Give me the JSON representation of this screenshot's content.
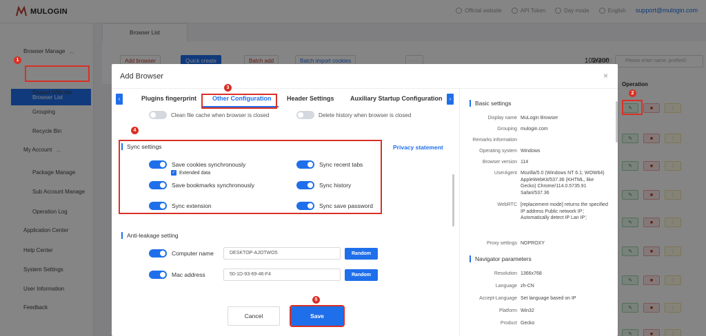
{
  "app": {
    "logo_text": "MULOGIN",
    "top_links": [
      "Official website",
      "API Token",
      "Day mode",
      "English"
    ],
    "email": "support@mulogin.com"
  },
  "sidebar": {
    "browser_manage": "Browser Manage",
    "browser_list": "Browser List",
    "shared_with_me": "Shared With Me",
    "grouping": "Grouping",
    "recycle_bin": "Recycle Bin",
    "my_account": "My Account",
    "package_manage": "Package Manage",
    "sub_account_manage": "Sub Account Manage",
    "operation_log": "Operation Log",
    "application_center": "Application Center",
    "help_center": "Help Center",
    "system_settings": "System Settings",
    "user_information": "User Information",
    "feedback": "Feedback"
  },
  "main": {
    "tab_label": "Browser List",
    "toolbar": {
      "add_browser": "Add browser",
      "quick_create": "Quick create",
      "batch_add": "Batch add",
      "batch_import": "Batch import cookies",
      "more": "· · ·"
    },
    "count": "102/200",
    "search_label": "Search :",
    "search_placeholder": "Please enter name, profileID",
    "operation_header": "Operation"
  },
  "modal": {
    "title": "Add Browser",
    "close": "×",
    "tabs": [
      "Plugins fingerprint",
      "Other Configuration",
      "Header Settings",
      "Auxiliary Startup Configuration"
    ],
    "prev_arrow": "‹",
    "next_arrow": "›",
    "faded": {
      "clean_cache": "Clean file cache when browser is closed",
      "delete_history": "Delete history when browser is closed"
    },
    "sync": {
      "title": "Sync settings",
      "privacy": "Privacy statement",
      "cookies": "Save cookies synchronously",
      "extended": "Extended data",
      "bookmarks": "Save bookmarks synchronously",
      "extension": "Sync extension",
      "recent_tabs": "Sync recent tabs",
      "history": "Sync history",
      "save_password": "Sync save password"
    },
    "anti_leakage": {
      "title": "Anti-leakage setting",
      "computer_name_label": "Computer name",
      "computer_name_value": "DESKTOP-AJOTWO5",
      "mac_label": "Mac address",
      "mac_value": "50-1D-93-69-46-F4",
      "random": "Random"
    },
    "cancel": "Cancel",
    "save": "Save",
    "basic": {
      "title": "Basic settings",
      "rows": [
        {
          "key": "Display name",
          "val": "MuLogin Browser"
        },
        {
          "key": "Grouping",
          "val": "mulogin.com"
        },
        {
          "key": "Remarks information",
          "val": ""
        },
        {
          "key": "Operating system",
          "val": "Windows"
        },
        {
          "key": "Browser version",
          "val": "114"
        },
        {
          "key": "UserAgent",
          "val": "Mozilla/5.0 (Windows NT 6.1; WOW64) AppleWebKit/537.36 (KHTML, like Gecko) Chrome/114.0.5735.91 Safari/537.36"
        },
        {
          "key": "WebRTC",
          "val": "[replacement mode] returns the specified IP address Public network IP：Automatically detect IP Lan IP："
        },
        {
          "key": "Proxy settings",
          "val": "NOPROXY"
        }
      ]
    },
    "navigator": {
      "title": "Navigator parameters",
      "rows": [
        {
          "key": "Resolution",
          "val": "1366x768"
        },
        {
          "key": "Language",
          "val": "zh-CN"
        },
        {
          "key": "Accept-Language",
          "val": "Set language based on IP"
        },
        {
          "key": "Platform",
          "val": "Win32"
        },
        {
          "key": "Product",
          "val": "Gecko"
        }
      ]
    }
  },
  "steps": [
    "1",
    "2",
    "3",
    "4",
    "5"
  ],
  "colors": {
    "accent": "#1f6feb",
    "highlight": "#d93025"
  }
}
